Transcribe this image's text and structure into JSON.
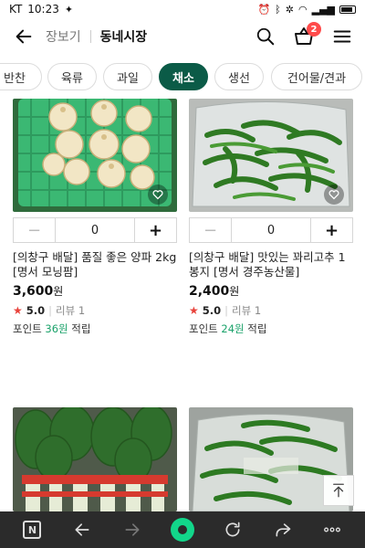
{
  "status_bar": {
    "carrier": "KT",
    "time": "10:23"
  },
  "header": {
    "parent": "장보기",
    "title": "동네시장",
    "cart_count": "2"
  },
  "tabs": [
    {
      "label": "반찬"
    },
    {
      "label": "육류"
    },
    {
      "label": "과일"
    },
    {
      "label": "채소",
      "active": true
    },
    {
      "label": "생선"
    },
    {
      "label": "건어물/견과"
    }
  ],
  "products": [
    {
      "title": "[의창구 배달] 품질 좋은 양파 2kg [명서 모닝팜]",
      "price": "3,600",
      "price_unit": "원",
      "rating": "5.0",
      "review_label": "리뷰 1",
      "point_prefix": "포인트 ",
      "point_value": "36원",
      "point_suffix": " 적립",
      "quantity": "0"
    },
    {
      "title": "[의창구 배달] 맛있는 꽈리고추 1봉지 [명서 경주농산물]",
      "price": "2,400",
      "price_unit": "원",
      "rating": "5.0",
      "review_label": "리뷰 1",
      "point_prefix": "포인트 ",
      "point_value": "24원",
      "point_suffix": " 적립",
      "quantity": "0"
    },
    {
      "title": "",
      "price": "",
      "price_unit": "",
      "rating": "",
      "review_label": "",
      "point_prefix": "",
      "point_value": "",
      "point_suffix": "",
      "quantity": ""
    },
    {
      "title": "",
      "price": "",
      "price_unit": "",
      "rating": "",
      "review_label": "",
      "point_prefix": "",
      "point_value": "",
      "point_suffix": "",
      "quantity": ""
    }
  ],
  "browser_bar": {
    "logo": "N"
  },
  "colors": {
    "active_tab": "#0b5b47",
    "badge": "#ff4b4b",
    "point": "#1aa26a",
    "star": "#e8423b",
    "browser_bar": "#2b2b2b",
    "browser_accent": "#12d68a"
  }
}
